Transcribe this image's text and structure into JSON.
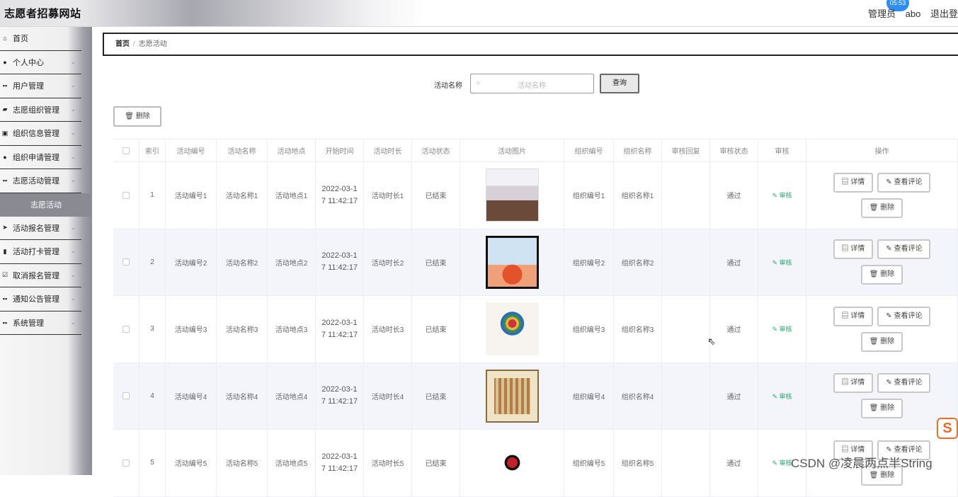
{
  "app": {
    "title": "志愿者招募网站",
    "clock": "05:53",
    "user_role_text": "管理员",
    "username": "abo",
    "logout": "退出登"
  },
  "sidebar": {
    "items": [
      {
        "label": "首页",
        "icon": "home-icon",
        "chevron": false
      },
      {
        "label": "个人中心",
        "icon": "user-icon",
        "chevron": true
      },
      {
        "label": "用户管理",
        "icon": "grid-icon",
        "chevron": true
      },
      {
        "label": "志愿组织管理",
        "icon": "folder-icon",
        "chevron": true
      },
      {
        "label": "组织信息管理",
        "icon": "doc-icon",
        "chevron": true
      },
      {
        "label": "组织申请管理",
        "icon": "user-icon",
        "chevron": true
      },
      {
        "label": "志愿活动管理",
        "icon": "grid-icon",
        "chevron": true
      }
    ],
    "sub_active": "志愿活动",
    "items2": [
      {
        "label": "活动报名管理",
        "icon": "send-icon",
        "chevron": true
      },
      {
        "label": "活动打卡管理",
        "icon": "bar-chart-icon",
        "chevron": true
      },
      {
        "label": "取消报名管理",
        "icon": "check-square-icon",
        "chevron": true
      },
      {
        "label": "通知公告管理",
        "icon": "grid-icon",
        "chevron": true
      },
      {
        "label": "系统管理",
        "icon": "grid-icon",
        "chevron": true
      }
    ]
  },
  "breadcrumb": {
    "home": "首页",
    "sep": "/",
    "current": "志愿活动"
  },
  "search": {
    "label": "活动名称",
    "placeholder": "活动名称",
    "button": "查询"
  },
  "toolbar": {
    "delete_label": "删除"
  },
  "table": {
    "headers": [
      "索引",
      "活动编号",
      "活动名称",
      "活动地点",
      "开始时间",
      "活动时长",
      "活动状态",
      "活动图片",
      "组织编号",
      "组织名称",
      "审核回复",
      "审核状态",
      "审核",
      "操作"
    ],
    "rows": [
      {
        "index": "1",
        "code": "活动编号1",
        "name": "活动名称1",
        "place": "活动地点1",
        "time1": "2022-03-1",
        "time2": "7 11:42:17",
        "duration": "活动时长1",
        "status": "已结束",
        "org_code": "组织编号1",
        "org_name": "组织名称1",
        "reply": "",
        "audit_status": "通过",
        "audit": "审核"
      },
      {
        "index": "2",
        "code": "活动编号2",
        "name": "活动名称2",
        "place": "活动地点2",
        "time1": "2022-03-1",
        "time2": "7 11:42:17",
        "duration": "活动时长2",
        "status": "已结束",
        "org_code": "组织编号2",
        "org_name": "组织名称2",
        "reply": "",
        "audit_status": "通过",
        "audit": "审核"
      },
      {
        "index": "3",
        "code": "活动编号3",
        "name": "活动名称3",
        "place": "活动地点3",
        "time1": "2022-03-1",
        "time2": "7 11:42:17",
        "duration": "活动时长3",
        "status": "已结束",
        "org_code": "组织编号3",
        "org_name": "组织名称3",
        "reply": "",
        "audit_status": "通过",
        "audit": "审核"
      },
      {
        "index": "4",
        "code": "活动编号4",
        "name": "活动名称4",
        "place": "活动地点4",
        "time1": "2022-03-1",
        "time2": "7 11:42:17",
        "duration": "活动时长4",
        "status": "已结束",
        "org_code": "组织编号4",
        "org_name": "组织名称4",
        "reply": "",
        "audit_status": "通过",
        "audit": "审核"
      },
      {
        "index": "5",
        "code": "活动编号5",
        "name": "活动名称5",
        "place": "活动地点5",
        "time1": "2022-03-1",
        "time2": "7 11:42:17",
        "duration": "活动时长5",
        "status": "已结束",
        "org_code": "组织编号5",
        "org_name": "组织名称5",
        "reply": "",
        "audit_status": "通过",
        "audit": "审核"
      }
    ],
    "ops": {
      "detail": "详情",
      "comments": "查看评论",
      "delete": "删除"
    }
  },
  "watermark": "CSDN @凌晨两点半String",
  "colors": {
    "audit_green": "#2aa86d",
    "active_menu_bg": "#8a8a92",
    "row_alt_bg": "#f3f5fa"
  }
}
